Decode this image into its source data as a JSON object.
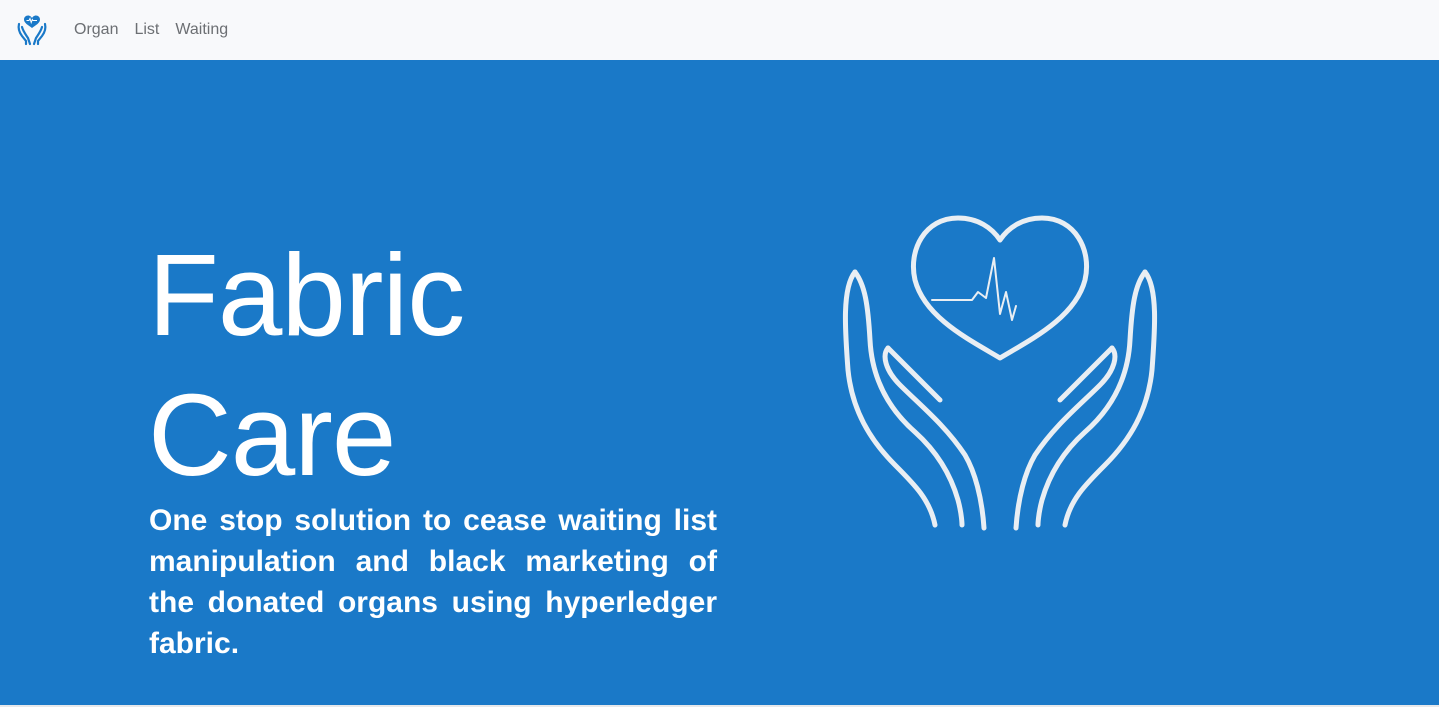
{
  "navbar": {
    "brand_icon": "heart-hands-logo-icon",
    "links": [
      {
        "label": "Organ"
      },
      {
        "label": "List"
      },
      {
        "label": "Waiting"
      }
    ]
  },
  "hero": {
    "title": "Fabric Care",
    "subtitle": "One stop solution to cease waiting list manipulation and black marketing of the donated organs using hyperledger fabric.",
    "illustration_icon": "heart-in-hands-icon"
  },
  "colors": {
    "navbar_background": "#f8f9fb",
    "hero_background": "#1a79c8",
    "hero_text": "#ffffff",
    "nav_link_text": "#6c6f73",
    "illustration_stroke": "#e9eef3"
  }
}
